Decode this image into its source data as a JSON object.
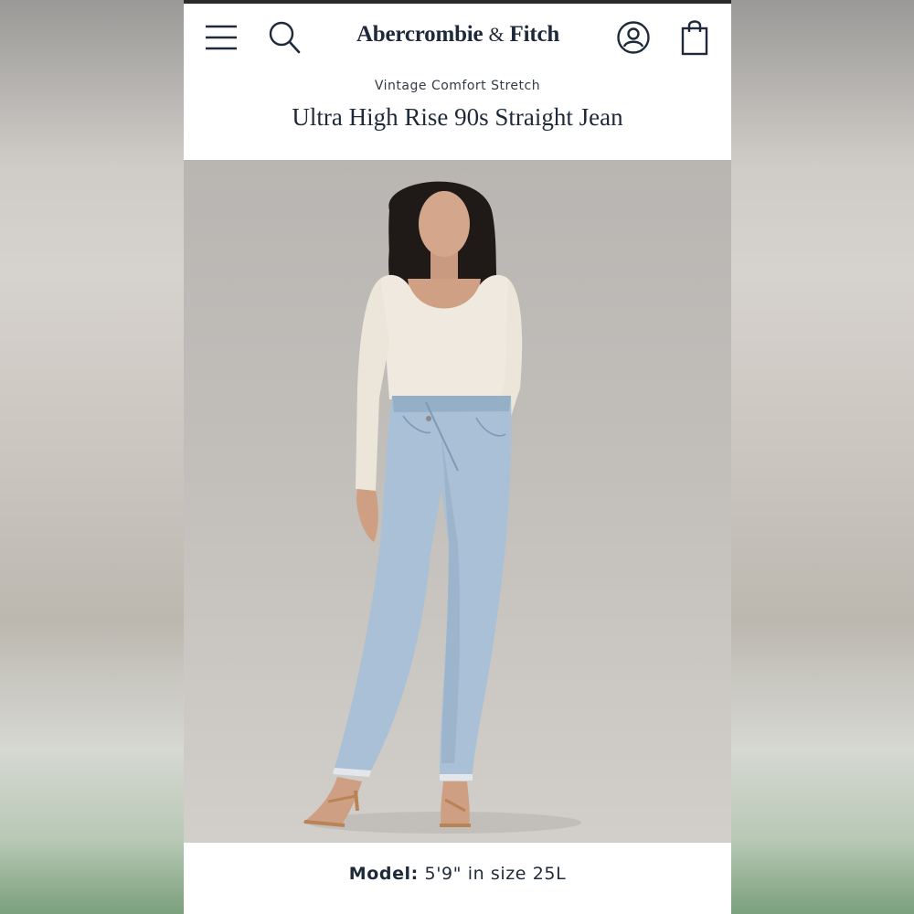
{
  "header": {
    "brand_name": "Abercrombie",
    "brand_amp": "&",
    "brand_name2": "Fitch"
  },
  "product": {
    "eyebrow": "Vintage Comfort Stretch",
    "title": "Ultra High Rise 90s Straight Jean",
    "image_description_icon": "model-photo"
  },
  "caption": {
    "label": "Model:",
    "value": " 5'9\" in size 25L"
  },
  "icons": {
    "menu": "hamburger-menu-icon",
    "search": "search-icon",
    "account": "account-icon",
    "bag": "shopping-bag-icon"
  },
  "colors": {
    "brand_navy": "#1e2a3a",
    "photo_bg": "#c2beba",
    "denim": "#a9c0d6"
  }
}
